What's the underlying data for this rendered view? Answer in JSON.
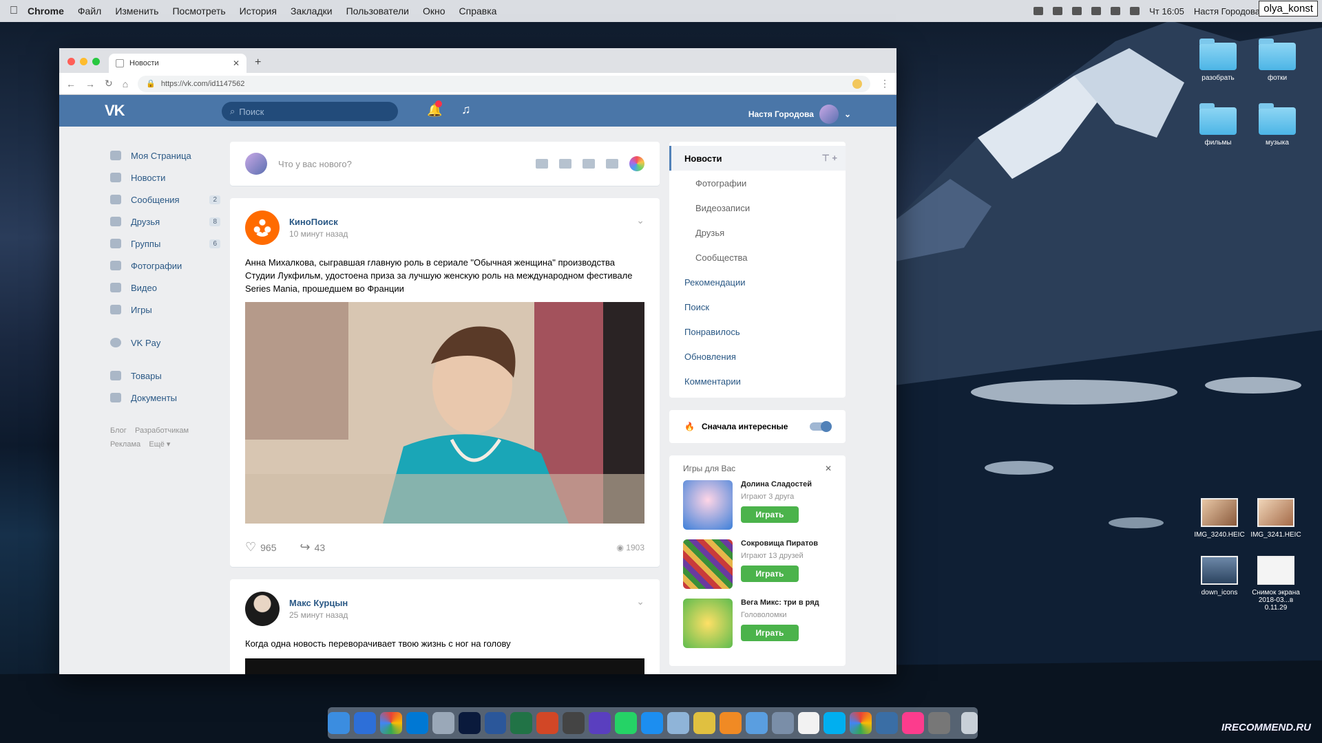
{
  "menubar": {
    "app": "Chrome",
    "menus": [
      "Файл",
      "Изменить",
      "Посмотреть",
      "История",
      "Закладки",
      "Пользователи",
      "Окно",
      "Справка"
    ],
    "clock": "Чт 16:05",
    "user": "Настя Городова"
  },
  "overlay_user": "olya_konst",
  "desktop": {
    "folders": [
      {
        "label": "разобрать"
      },
      {
        "label": "фотки"
      },
      {
        "label": "фильмы"
      },
      {
        "label": "музыка"
      }
    ],
    "files": [
      {
        "label": "IMG_3240.HEIC"
      },
      {
        "label": "IMG_3241.HEIC"
      },
      {
        "label": "down_icons"
      },
      {
        "label": "Снимок экрана 2018-03...в 0.11.29"
      }
    ]
  },
  "browser": {
    "tab_title": "Новости",
    "url": "https://vk.com/id1147562"
  },
  "vk": {
    "search_placeholder": "Поиск",
    "user_name": "Настя Городова",
    "left_nav": [
      {
        "label": "Моя Страница",
        "count": ""
      },
      {
        "label": "Новости",
        "count": ""
      },
      {
        "label": "Сообщения",
        "count": "2"
      },
      {
        "label": "Друзья",
        "count": "8"
      },
      {
        "label": "Группы",
        "count": "6"
      },
      {
        "label": "Фотографии",
        "count": ""
      },
      {
        "label": "Видео",
        "count": ""
      },
      {
        "label": "Игры",
        "count": ""
      }
    ],
    "left_nav_2": [
      {
        "label": "VK Pay"
      }
    ],
    "left_nav_3": [
      {
        "label": "Товары"
      },
      {
        "label": "Документы"
      }
    ],
    "footer": {
      "blog": "Блог",
      "dev": "Разработчикам",
      "ads": "Реклама",
      "more": "Ещё ▾"
    },
    "composer_placeholder": "Что у вас нового?",
    "posts": [
      {
        "author": "КиноПоиск",
        "time": "10 минут назад",
        "text": "Анна Михалкова, сыгравшая главную роль в сериале \"Обычная женщина\" производства Студии Лукфильм, удостоена приза за лучшую женскую роль на международном фестивале Series Mania, прошедшем во Франции",
        "likes": "965",
        "shares": "43",
        "views": "1903"
      },
      {
        "author": "Макс Курцын",
        "time": "25 минут назад",
        "text": "Когда одна новость переворачивает твою жизнь с ног на голову"
      }
    ],
    "right_menu": {
      "active": "Новости",
      "sub": [
        "Фотографии",
        "Видеозаписи",
        "Друзья",
        "Сообщества"
      ],
      "main": [
        "Рекомендации",
        "Поиск",
        "Понравилось",
        "Обновления",
        "Комментарии"
      ]
    },
    "interesting_first": "Сначала интересные",
    "games_title": "Игры для Вас",
    "games": [
      {
        "name": "Долина Сладостей",
        "sub": "Играют 3 друга",
        "play": "Играть"
      },
      {
        "name": "Сокровища Пиратов",
        "sub": "Играют 13 друзей",
        "play": "Играть"
      },
      {
        "name": "Вега Микс: три в ряд",
        "sub": "Головоломки",
        "play": "Играть"
      }
    ]
  },
  "watermark": "IRECOMMEND.RU"
}
